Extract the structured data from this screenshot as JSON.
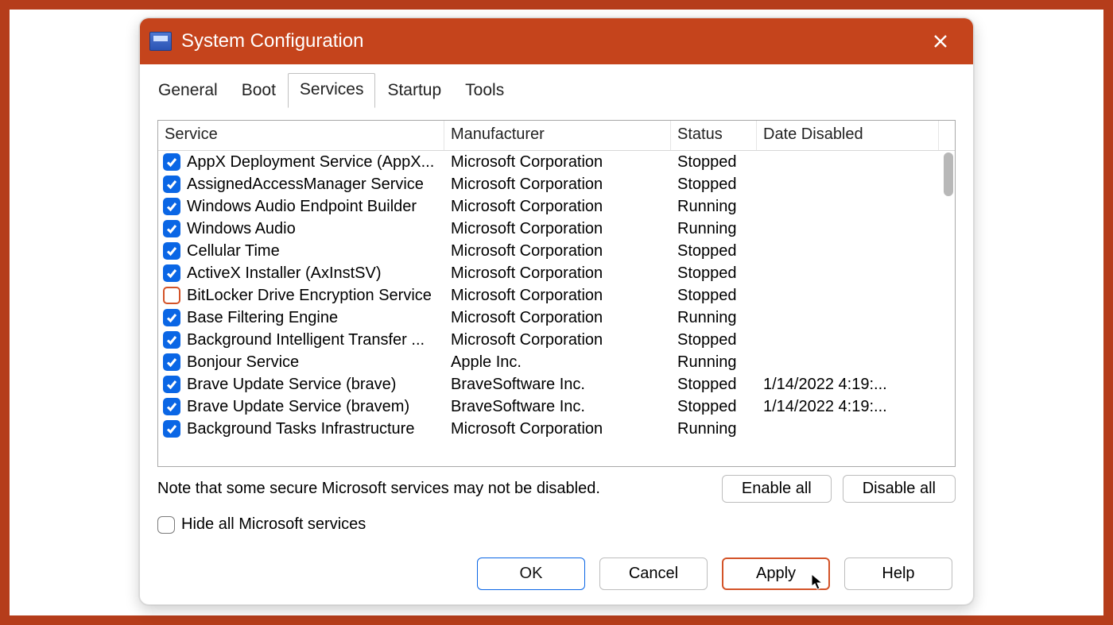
{
  "window": {
    "title": "System Configuration"
  },
  "tabs": [
    {
      "label": "General",
      "active": false
    },
    {
      "label": "Boot",
      "active": false
    },
    {
      "label": "Services",
      "active": true
    },
    {
      "label": "Startup",
      "active": false
    },
    {
      "label": "Tools",
      "active": false
    }
  ],
  "columns": {
    "service": "Service",
    "manufacturer": "Manufacturer",
    "status": "Status",
    "date_disabled": "Date Disabled"
  },
  "services": [
    {
      "checked": true,
      "name": "AppX Deployment Service (AppX...",
      "manufacturer": "Microsoft Corporation",
      "status": "Stopped",
      "date_disabled": ""
    },
    {
      "checked": true,
      "name": "AssignedAccessManager Service",
      "manufacturer": "Microsoft Corporation",
      "status": "Stopped",
      "date_disabled": ""
    },
    {
      "checked": true,
      "name": "Windows Audio Endpoint Builder",
      "manufacturer": "Microsoft Corporation",
      "status": "Running",
      "date_disabled": ""
    },
    {
      "checked": true,
      "name": "Windows Audio",
      "manufacturer": "Microsoft Corporation",
      "status": "Running",
      "date_disabled": ""
    },
    {
      "checked": true,
      "name": "Cellular Time",
      "manufacturer": "Microsoft Corporation",
      "status": "Stopped",
      "date_disabled": ""
    },
    {
      "checked": true,
      "name": "ActiveX Installer (AxInstSV)",
      "manufacturer": "Microsoft Corporation",
      "status": "Stopped",
      "date_disabled": ""
    },
    {
      "checked": false,
      "name": "BitLocker Drive Encryption Service",
      "manufacturer": "Microsoft Corporation",
      "status": "Stopped",
      "date_disabled": ""
    },
    {
      "checked": true,
      "name": "Base Filtering Engine",
      "manufacturer": "Microsoft Corporation",
      "status": "Running",
      "date_disabled": ""
    },
    {
      "checked": true,
      "name": "Background Intelligent Transfer ...",
      "manufacturer": "Microsoft Corporation",
      "status": "Stopped",
      "date_disabled": ""
    },
    {
      "checked": true,
      "name": "Bonjour Service",
      "manufacturer": "Apple Inc.",
      "status": "Running",
      "date_disabled": ""
    },
    {
      "checked": true,
      "name": "Brave Update Service (brave)",
      "manufacturer": "BraveSoftware Inc.",
      "status": "Stopped",
      "date_disabled": "1/14/2022 4:19:..."
    },
    {
      "checked": true,
      "name": "Brave Update Service (bravem)",
      "manufacturer": "BraveSoftware Inc.",
      "status": "Stopped",
      "date_disabled": "1/14/2022 4:19:..."
    },
    {
      "checked": true,
      "name": "Background Tasks Infrastructure",
      "manufacturer": "Microsoft Corporation",
      "status": "Running",
      "date_disabled": ""
    }
  ],
  "note": "Note that some secure Microsoft services may not be disabled.",
  "buttons": {
    "enable_all": "Enable all",
    "disable_all": "Disable all",
    "hide_ms_label": "Hide all Microsoft services",
    "hide_ms_checked": false,
    "ok": "OK",
    "cancel": "Cancel",
    "apply": "Apply",
    "help": "Help"
  }
}
